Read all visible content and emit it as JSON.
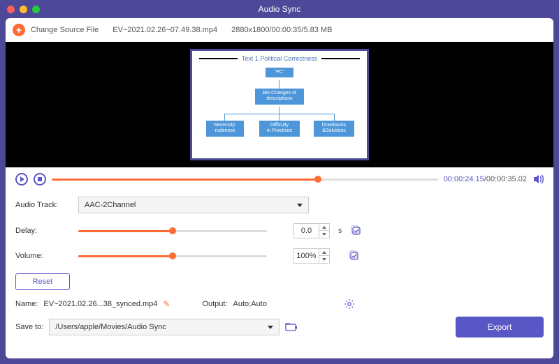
{
  "window": {
    "title": "Audio Sync"
  },
  "toolbar": {
    "change_source": "Change Source File",
    "filename": "EV~2021.02.26~07.49.38.mp4",
    "meta": "2880x1800/00:00:35/5.83 MB"
  },
  "preview_slide": {
    "heading": "Text 1  Political Correctness",
    "pc": "\"PC\"",
    "bg": "BG:Changes of descriptions",
    "c1a": "Necessity:",
    "c1b": "rudeness",
    "c2a": "Difficulty",
    "c2b": "in Practices",
    "c3a": "Drawbacks",
    "c3b": "&Solutions"
  },
  "transport": {
    "current": "00:00:24.15",
    "total": "00:00:35.02",
    "progress_pct": 69
  },
  "controls": {
    "audio_track_label": "Audio Track:",
    "audio_track_value": "AAC-2Channel",
    "delay_label": "Delay:",
    "delay_value": "0.0",
    "delay_unit": "s",
    "volume_label": "Volume:",
    "volume_value": "100%",
    "reset": "Reset"
  },
  "bottom": {
    "name_label": "Name:",
    "name_value": "EV~2021.02.26...38_synced.mp4",
    "output_label": "Output:",
    "output_value": "Auto;Auto",
    "saveto_label": "Save to:",
    "saveto_value": "/Users/apple/Movies/Audio Sync",
    "export": "Export"
  }
}
